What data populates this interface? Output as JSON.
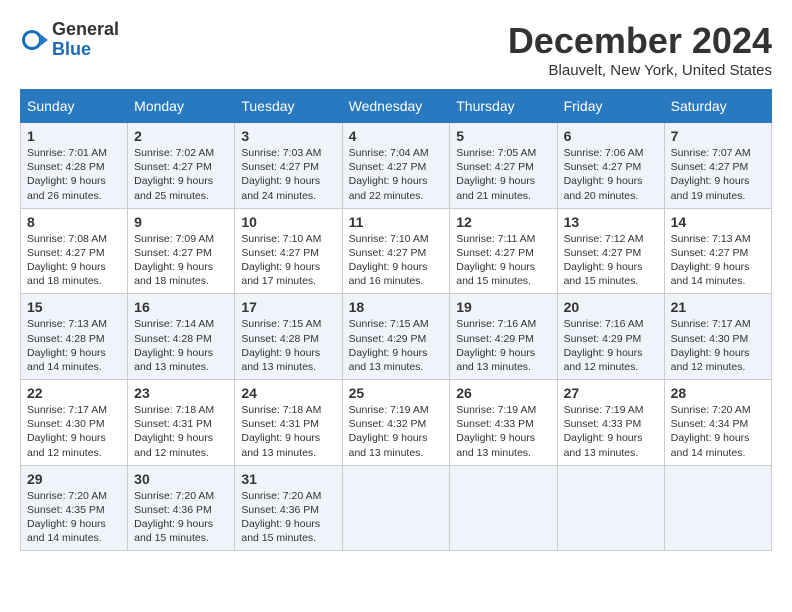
{
  "header": {
    "logo_general": "General",
    "logo_blue": "Blue",
    "month_title": "December 2024",
    "location": "Blauvelt, New York, United States"
  },
  "days_of_week": [
    "Sunday",
    "Monday",
    "Tuesday",
    "Wednesday",
    "Thursday",
    "Friday",
    "Saturday"
  ],
  "weeks": [
    [
      {
        "day": "1",
        "sunrise": "7:01 AM",
        "sunset": "4:28 PM",
        "daylight_hours": "9",
        "daylight_minutes": "26"
      },
      {
        "day": "2",
        "sunrise": "7:02 AM",
        "sunset": "4:27 PM",
        "daylight_hours": "9",
        "daylight_minutes": "25"
      },
      {
        "day": "3",
        "sunrise": "7:03 AM",
        "sunset": "4:27 PM",
        "daylight_hours": "9",
        "daylight_minutes": "24"
      },
      {
        "day": "4",
        "sunrise": "7:04 AM",
        "sunset": "4:27 PM",
        "daylight_hours": "9",
        "daylight_minutes": "22"
      },
      {
        "day": "5",
        "sunrise": "7:05 AM",
        "sunset": "4:27 PM",
        "daylight_hours": "9",
        "daylight_minutes": "21"
      },
      {
        "day": "6",
        "sunrise": "7:06 AM",
        "sunset": "4:27 PM",
        "daylight_hours": "9",
        "daylight_minutes": "20"
      },
      {
        "day": "7",
        "sunrise": "7:07 AM",
        "sunset": "4:27 PM",
        "daylight_hours": "9",
        "daylight_minutes": "19"
      }
    ],
    [
      {
        "day": "8",
        "sunrise": "7:08 AM",
        "sunset": "4:27 PM",
        "daylight_hours": "9",
        "daylight_minutes": "18"
      },
      {
        "day": "9",
        "sunrise": "7:09 AM",
        "sunset": "4:27 PM",
        "daylight_hours": "9",
        "daylight_minutes": "18"
      },
      {
        "day": "10",
        "sunrise": "7:10 AM",
        "sunset": "4:27 PM",
        "daylight_hours": "9",
        "daylight_minutes": "17"
      },
      {
        "day": "11",
        "sunrise": "7:10 AM",
        "sunset": "4:27 PM",
        "daylight_hours": "9",
        "daylight_minutes": "16"
      },
      {
        "day": "12",
        "sunrise": "7:11 AM",
        "sunset": "4:27 PM",
        "daylight_hours": "9",
        "daylight_minutes": "15"
      },
      {
        "day": "13",
        "sunrise": "7:12 AM",
        "sunset": "4:27 PM",
        "daylight_hours": "9",
        "daylight_minutes": "15"
      },
      {
        "day": "14",
        "sunrise": "7:13 AM",
        "sunset": "4:27 PM",
        "daylight_hours": "9",
        "daylight_minutes": "14"
      }
    ],
    [
      {
        "day": "15",
        "sunrise": "7:13 AM",
        "sunset": "4:28 PM",
        "daylight_hours": "9",
        "daylight_minutes": "14"
      },
      {
        "day": "16",
        "sunrise": "7:14 AM",
        "sunset": "4:28 PM",
        "daylight_hours": "9",
        "daylight_minutes": "13"
      },
      {
        "day": "17",
        "sunrise": "7:15 AM",
        "sunset": "4:28 PM",
        "daylight_hours": "9",
        "daylight_minutes": "13"
      },
      {
        "day": "18",
        "sunrise": "7:15 AM",
        "sunset": "4:29 PM",
        "daylight_hours": "9",
        "daylight_minutes": "13"
      },
      {
        "day": "19",
        "sunrise": "7:16 AM",
        "sunset": "4:29 PM",
        "daylight_hours": "9",
        "daylight_minutes": "13"
      },
      {
        "day": "20",
        "sunrise": "7:16 AM",
        "sunset": "4:29 PM",
        "daylight_hours": "9",
        "daylight_minutes": "12"
      },
      {
        "day": "21",
        "sunrise": "7:17 AM",
        "sunset": "4:30 PM",
        "daylight_hours": "9",
        "daylight_minutes": "12"
      }
    ],
    [
      {
        "day": "22",
        "sunrise": "7:17 AM",
        "sunset": "4:30 PM",
        "daylight_hours": "9",
        "daylight_minutes": "12"
      },
      {
        "day": "23",
        "sunrise": "7:18 AM",
        "sunset": "4:31 PM",
        "daylight_hours": "9",
        "daylight_minutes": "12"
      },
      {
        "day": "24",
        "sunrise": "7:18 AM",
        "sunset": "4:31 PM",
        "daylight_hours": "9",
        "daylight_minutes": "13"
      },
      {
        "day": "25",
        "sunrise": "7:19 AM",
        "sunset": "4:32 PM",
        "daylight_hours": "9",
        "daylight_minutes": "13"
      },
      {
        "day": "26",
        "sunrise": "7:19 AM",
        "sunset": "4:33 PM",
        "daylight_hours": "9",
        "daylight_minutes": "13"
      },
      {
        "day": "27",
        "sunrise": "7:19 AM",
        "sunset": "4:33 PM",
        "daylight_hours": "9",
        "daylight_minutes": "13"
      },
      {
        "day": "28",
        "sunrise": "7:20 AM",
        "sunset": "4:34 PM",
        "daylight_hours": "9",
        "daylight_minutes": "14"
      }
    ],
    [
      {
        "day": "29",
        "sunrise": "7:20 AM",
        "sunset": "4:35 PM",
        "daylight_hours": "9",
        "daylight_minutes": "14"
      },
      {
        "day": "30",
        "sunrise": "7:20 AM",
        "sunset": "4:36 PM",
        "daylight_hours": "9",
        "daylight_minutes": "15"
      },
      {
        "day": "31",
        "sunrise": "7:20 AM",
        "sunset": "4:36 PM",
        "daylight_hours": "9",
        "daylight_minutes": "15"
      },
      null,
      null,
      null,
      null
    ]
  ]
}
